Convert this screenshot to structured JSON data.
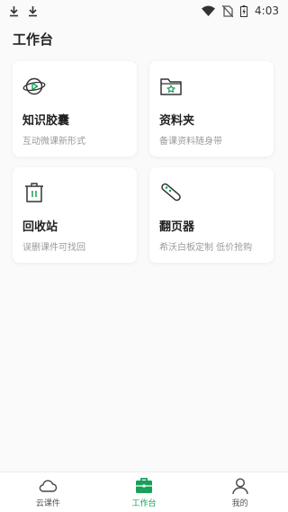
{
  "status_bar": {
    "time": "4:03"
  },
  "page": {
    "title": "工作台"
  },
  "cards": [
    {
      "title": "知识胶囊",
      "desc": "互动微课新形式",
      "icon": "capsule-play-icon"
    },
    {
      "title": "资料夹",
      "desc": "备课资料随身带",
      "icon": "folder-star-icon"
    },
    {
      "title": "回收站",
      "desc": "误删课件可找回",
      "icon": "trash-icon"
    },
    {
      "title": "翻页器",
      "desc": "希沃白板定制 低价抢购",
      "icon": "clicker-icon"
    }
  ],
  "tabs": [
    {
      "label": "云课件",
      "icon": "cloud-icon",
      "active": false
    },
    {
      "label": "工作台",
      "icon": "briefcase-icon",
      "active": true
    },
    {
      "label": "我的",
      "icon": "user-icon",
      "active": false
    }
  ],
  "colors": {
    "accent": "#18a058",
    "icon_stroke": "#333333",
    "card_bg": "#ffffff",
    "page_bg": "#fafafa"
  }
}
